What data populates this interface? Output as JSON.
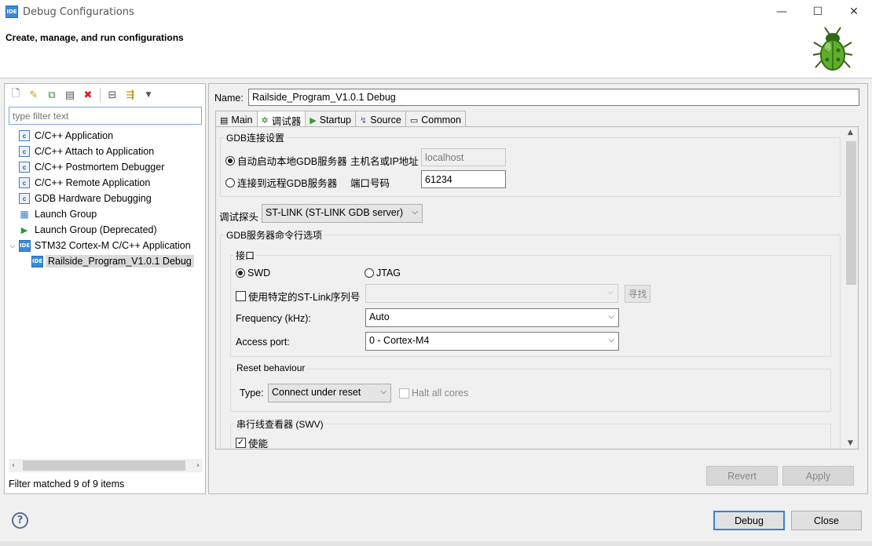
{
  "window": {
    "app_badge": "IDE",
    "title": "Debug Configurations",
    "min_glyph": "—",
    "max_glyph": "☐",
    "close_glyph": "✕"
  },
  "banner": {
    "heading": "Create, manage, and run configurations"
  },
  "left": {
    "toolbar": [
      "new-launch-config-icon",
      "new-prototype-icon",
      "duplicate-icon",
      "export-icon",
      "delete-icon",
      "collapse-all-icon",
      "filter-icon",
      "view-menu-icon"
    ],
    "filter_placeholder": "type filter text",
    "tree": [
      {
        "label": "C/C++ Application",
        "icon": "c-icon"
      },
      {
        "label": "C/C++ Attach to Application",
        "icon": "c-icon"
      },
      {
        "label": "C/C++ Postmortem Debugger",
        "icon": "c-icon"
      },
      {
        "label": "C/C++ Remote Application",
        "icon": "c-icon"
      },
      {
        "label": "GDB Hardware Debugging",
        "icon": "c-icon"
      },
      {
        "label": "Launch Group",
        "icon": "launch-group-icon"
      },
      {
        "label": "Launch Group (Deprecated)",
        "icon": "launch-arrow-icon"
      },
      {
        "label": "STM32 Cortex-M C/C++ Application",
        "icon": "ide-icon",
        "expanded": true
      },
      {
        "label": "Railside_Program_V1.0.1 Debug",
        "icon": "ide-icon",
        "selected": true
      }
    ],
    "filter_status": "Filter matched 9 of 9 items"
  },
  "right": {
    "name_label": "Name:",
    "name_value": "Railside_Program_V1.0.1 Debug",
    "tabs": [
      {
        "label": "Main",
        "icon": "main-tab-icon",
        "glyph": "▤"
      },
      {
        "label": "调试器",
        "icon": "debugger-tab-icon",
        "glyph": "✲",
        "active": true
      },
      {
        "label": "Startup",
        "icon": "startup-tab-icon",
        "glyph": "▶"
      },
      {
        "label": "Source",
        "icon": "source-tab-icon",
        "glyph": "↯"
      },
      {
        "label": "Common",
        "icon": "common-tab-icon",
        "glyph": "▭"
      }
    ],
    "gdb_group": {
      "title": "GDB连接设置",
      "local_label": "自动启动本地GDB服务器",
      "local_selected": true,
      "host_label": "主机名或IP地址",
      "host_value": "localhost",
      "remote_label": "连接到远程GDB服务器",
      "remote_selected": false,
      "port_label": "端口号码",
      "port_value": "61234"
    },
    "probe_label": "调试探头",
    "probe_value": "ST-LINK (ST-LINK GDB server)",
    "server_group_title": "GDB服务器命令行选项",
    "interface": {
      "title": "接口",
      "swd_label": "SWD",
      "swd_selected": true,
      "jtag_label": "JTAG",
      "jtag_selected": false,
      "serial_label": "使用特定的ST-Link序列号",
      "serial_checked": false,
      "serial_value": "",
      "find_button": "寻找",
      "freq_label": "Frequency (kHz):",
      "freq_value": "Auto",
      "port_label": "Access port:",
      "port_value": "0 - Cortex-M4"
    },
    "reset": {
      "title": "Reset behaviour",
      "type_label": "Type:",
      "type_value": "Connect under reset",
      "halt_label": "Halt all cores",
      "halt_checked": false
    },
    "swv": {
      "title": "串行线查看器 (SWV)",
      "enable_label": "使能",
      "enable_checked": true
    },
    "revert_button": "Revert",
    "apply_button": "Apply"
  },
  "footer": {
    "help_glyph": "?",
    "debug_button": "Debug",
    "close_button": "Close"
  }
}
